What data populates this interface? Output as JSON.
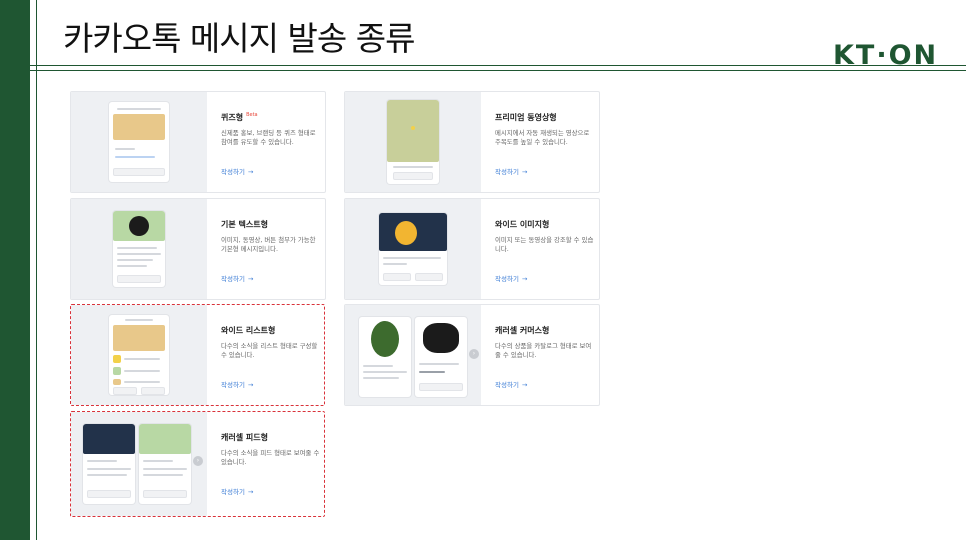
{
  "page": {
    "title": "카카오톡 메시지 발송 종류",
    "logo": "KT·ON",
    "accent": "#1f5632"
  },
  "cards": [
    {
      "id": "quiz",
      "title": "퀴즈형",
      "badge": "Beta",
      "desc": "신제품 홍보, 브랜딩 등 퀴즈 형태로 참여를 유도할 수 있습니다.",
      "cta": "작성하기",
      "highlighted": false
    },
    {
      "id": "basic-text",
      "title": "기본 텍스트형",
      "badge": "",
      "desc": "이미지, 동영상, 버튼 첨부가 가능한 기본형 메시지입니다.",
      "cta": "작성하기",
      "highlighted": false
    },
    {
      "id": "wide-list",
      "title": "와이드 리스트형",
      "badge": "",
      "desc": "다수의 소식을 리스트 형태로 구성할 수 있습니다.",
      "cta": "작성하기",
      "highlighted": true
    },
    {
      "id": "carousel-feed",
      "title": "캐러셀 피드형",
      "badge": "",
      "desc": "다수의 소식을 피드 형태로 보여줄 수 있습니다.",
      "cta": "작성하기",
      "highlighted": true
    },
    {
      "id": "premium-video",
      "title": "프리미엄 동영상형",
      "badge": "",
      "desc": "메시지에서 자동 재생되는 영상으로 주목도를 높일 수 있습니다.",
      "cta": "작성하기",
      "highlighted": false
    },
    {
      "id": "wide-image",
      "title": "와이드 이미지형",
      "badge": "",
      "desc": "이미지 또는 동영상을 강조할 수 있습니다.",
      "cta": "작성하기",
      "highlighted": false
    },
    {
      "id": "carousel-commerce",
      "title": "캐러셀 커머스형",
      "badge": "",
      "desc": "다수의 상품을 카탈로그 형태로 보여줄 수 있습니다.",
      "cta": "작성하기",
      "highlighted": false
    }
  ]
}
